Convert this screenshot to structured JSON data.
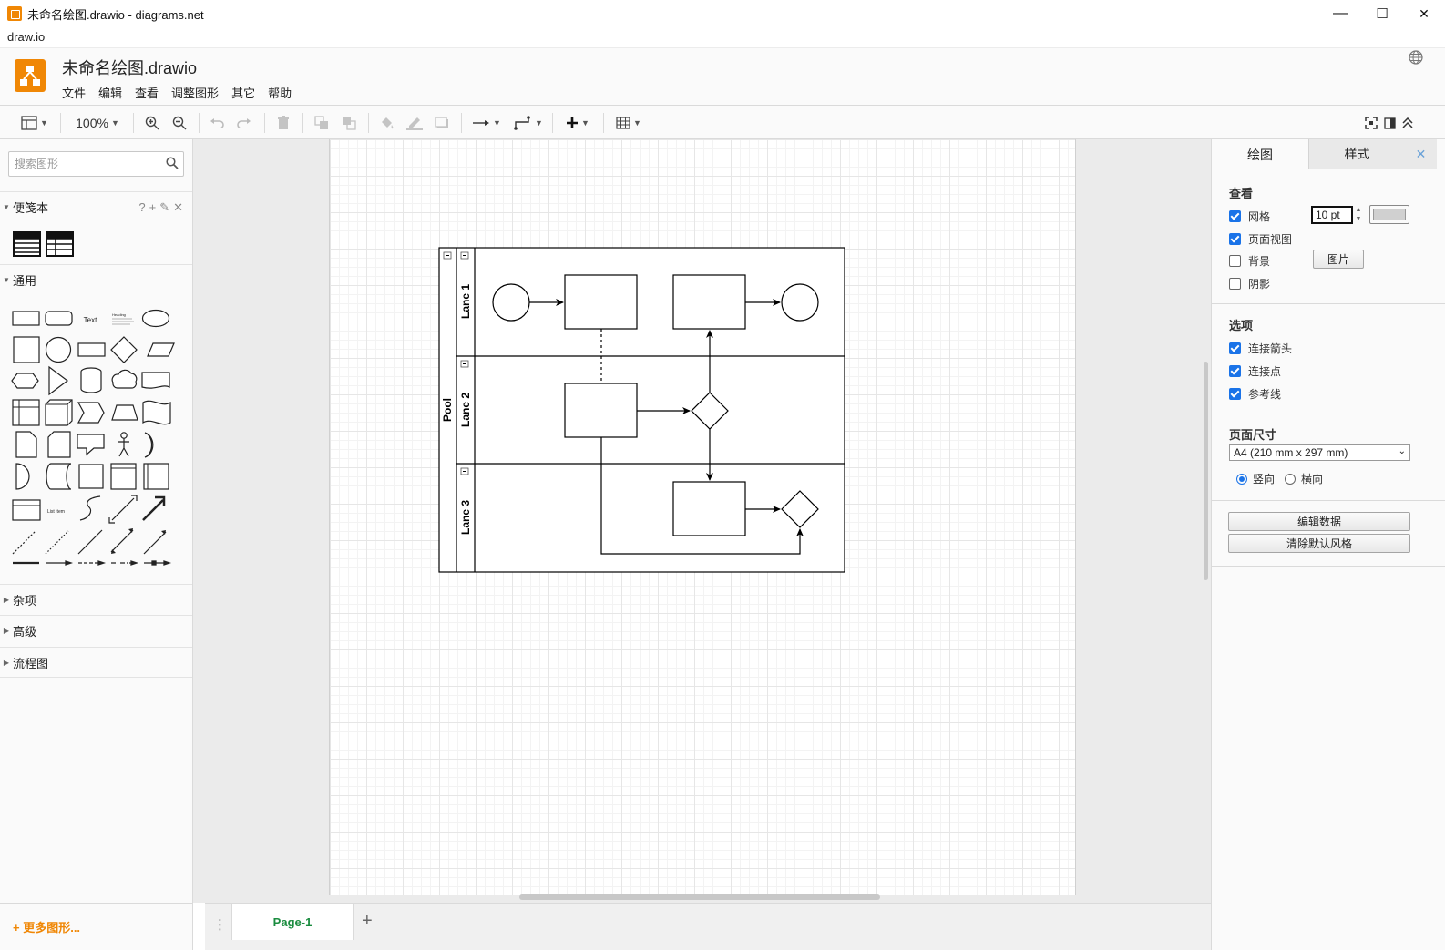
{
  "window": {
    "title": "未命名绘图.drawio - diagrams.net",
    "menubar_label": "draw.io",
    "minimize": "—",
    "maximize": "☐",
    "close": "✕"
  },
  "header": {
    "document_name": "未命名绘图.drawio",
    "menu": [
      "文件",
      "编辑",
      "查看",
      "调整图形",
      "其它",
      "帮助"
    ]
  },
  "toolbar": {
    "zoom": "100%"
  },
  "sidebar": {
    "search_placeholder": "搜索图形",
    "scratchpad": "便笺本",
    "general": "通用",
    "collapsed_sections": [
      "杂项",
      "高级",
      "流程图"
    ],
    "more_shapes": "+ 更多图形...",
    "shape_text_label": "Text",
    "shape_heading_label": "Heading",
    "shape_listitem_label": "List Item"
  },
  "diagram": {
    "pool": "Pool",
    "lanes": [
      "Lane 1",
      "Lane 2",
      "Lane 3"
    ]
  },
  "pages": {
    "active": "Page-1",
    "add": "+"
  },
  "format_panel": {
    "tabs": {
      "diagram": "绘图",
      "style": "样式"
    },
    "view": {
      "title": "查看",
      "grid": "网格",
      "grid_size": "10 pt",
      "page_view": "页面视图",
      "background": "背景",
      "image_button": "图片",
      "shadow": "阴影",
      "grid_enabled": true,
      "page_view_enabled": true,
      "background_enabled": false,
      "shadow_enabled": false
    },
    "options": {
      "title": "选项",
      "connection_arrows": "连接箭头",
      "connection_points": "连接点",
      "guides": "参考线"
    },
    "page_size": {
      "title": "页面尺寸",
      "selected": "A4 (210 mm x 297 mm)",
      "portrait": "竖向",
      "landscape": "横向"
    },
    "edit_data": "编辑数据",
    "clear_default_style": "清除默认风格"
  },
  "colors": {
    "accent": "#f08705",
    "page_tab": "#1a8c3f",
    "checkbox": "#1a73e8"
  }
}
